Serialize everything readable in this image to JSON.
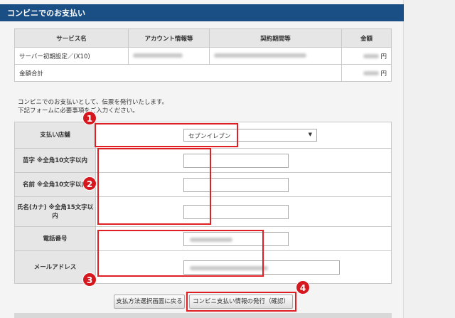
{
  "header": {
    "title": "コンビニでのお支払い"
  },
  "summary": {
    "headers": [
      "サービス名",
      "アカウント情報等",
      "契約期間等",
      "金額"
    ],
    "row": {
      "service": "サーバー初期設定／(X10)",
      "yen": "円"
    },
    "total": {
      "label": "金額合計",
      "yen": "円"
    }
  },
  "note": {
    "line1": "コンビニでのお支払いとして、伝票を発行いたします。",
    "line2": "下記フォームに必要事項をご入力ください。"
  },
  "form": {
    "store_label": "支払い店舗",
    "store_value": "セブンイレブン",
    "store_arrow": "▼",
    "surname_label": "苗字 ※全角10文字以内",
    "given_label": "名前 ※全角10文字以内",
    "kana_label": "氏名(カナ) ※全角15文字以内",
    "phone_label": "電話番号",
    "email_label": "メールアドレス"
  },
  "buttons": {
    "back": "支払方法選択画面に戻る",
    "confirm": "コンビニ支払い情報の発行（確認）"
  },
  "badges": [
    "1",
    "2",
    "3",
    "4"
  ]
}
